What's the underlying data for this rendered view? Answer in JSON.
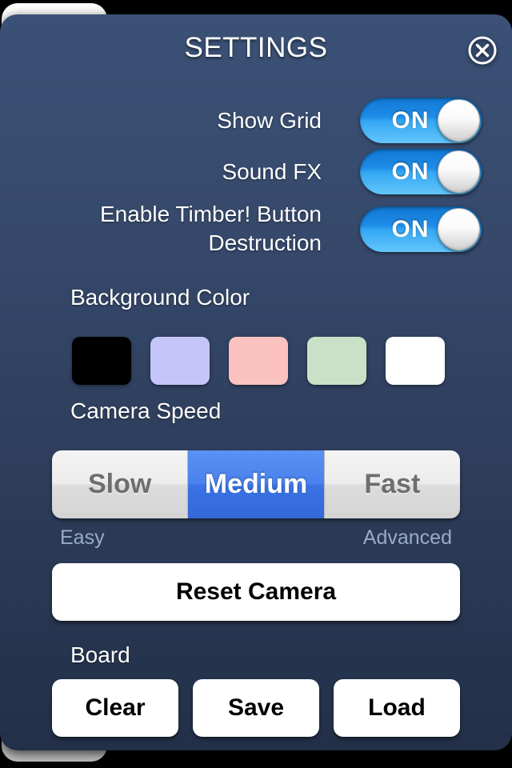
{
  "dialog": {
    "title": "SETTINGS",
    "close_icon": "close-circle-icon",
    "panel_color": "#36496b"
  },
  "toggles": [
    {
      "label": "Show Grid",
      "value": "ON",
      "state": true
    },
    {
      "label": "Sound FX",
      "value": "ON",
      "state": true
    },
    {
      "label": "Enable Timber! Button Destruction",
      "value": "ON",
      "state": true
    }
  ],
  "background_color": {
    "heading": "Background Color",
    "swatches": [
      {
        "name": "black",
        "hex": "#000000"
      },
      {
        "name": "lavender",
        "hex": "#c5c5fa"
      },
      {
        "name": "pink",
        "hex": "#fcc2c0"
      },
      {
        "name": "mint",
        "hex": "#c9e2c7"
      },
      {
        "name": "white",
        "hex": "#ffffff"
      }
    ]
  },
  "camera_speed": {
    "heading": "Camera Speed",
    "options": [
      "Slow",
      "Medium",
      "Fast"
    ],
    "selected": "Medium",
    "hint_left": "Easy",
    "hint_right": "Advanced",
    "selected_color": "#4a82ee"
  },
  "reset_camera": {
    "label": "Reset Camera"
  },
  "board": {
    "heading": "Board",
    "buttons": [
      "Clear",
      "Save",
      "Load"
    ]
  }
}
